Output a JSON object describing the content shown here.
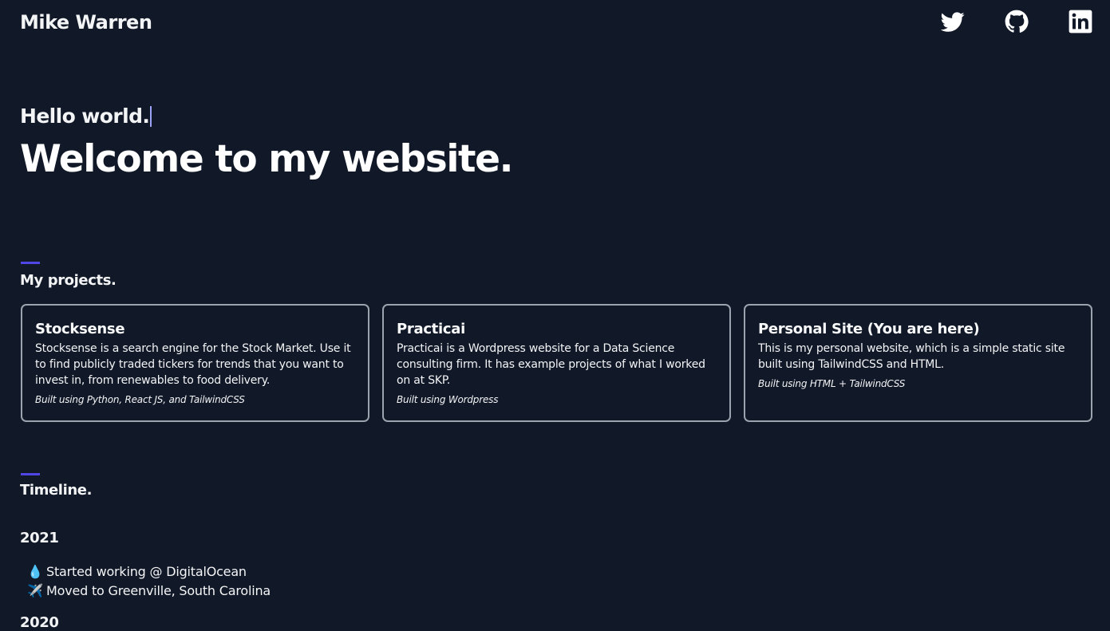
{
  "header": {
    "brand": "Mike Warren",
    "social": [
      {
        "icon": "twitter-icon"
      },
      {
        "icon": "github-icon"
      },
      {
        "icon": "linkedin-icon"
      }
    ]
  },
  "hero": {
    "greeting": "Hello world.",
    "headline": "Welcome to my website."
  },
  "projects": {
    "title": "My projects.",
    "items": [
      {
        "name": "Stocksense",
        "description": "Stocksense is a search engine for the Stock Market. Use it to find publicly traded tickers for trends that you want to invest in, from renewables to food delivery.",
        "built": "Built using Python, React JS, and TailwindCSS"
      },
      {
        "name": "Practicai",
        "description": "Practicai is a Wordpress website for a Data Science consulting firm. It has example projects of what I worked on at SKP.",
        "built": "Built using Wordpress"
      },
      {
        "name": "Personal Site (You are here)",
        "description": "This is my personal website, which is a simple static site built using TailwindCSS and HTML.",
        "built": "Built using HTML + TailwindCSS"
      }
    ]
  },
  "timeline": {
    "title": "Timeline.",
    "years": [
      {
        "year": "2021",
        "events": [
          {
            "emoji": "💧",
            "text": "Started working @ DigitalOcean"
          },
          {
            "emoji": "✈️",
            "text": "Moved to Greenville, South Carolina"
          }
        ]
      },
      {
        "year": "2020"
      }
    ]
  },
  "colors": {
    "background": "#111827",
    "accent": "#4f46e5",
    "card_border": "#9ca3af"
  }
}
